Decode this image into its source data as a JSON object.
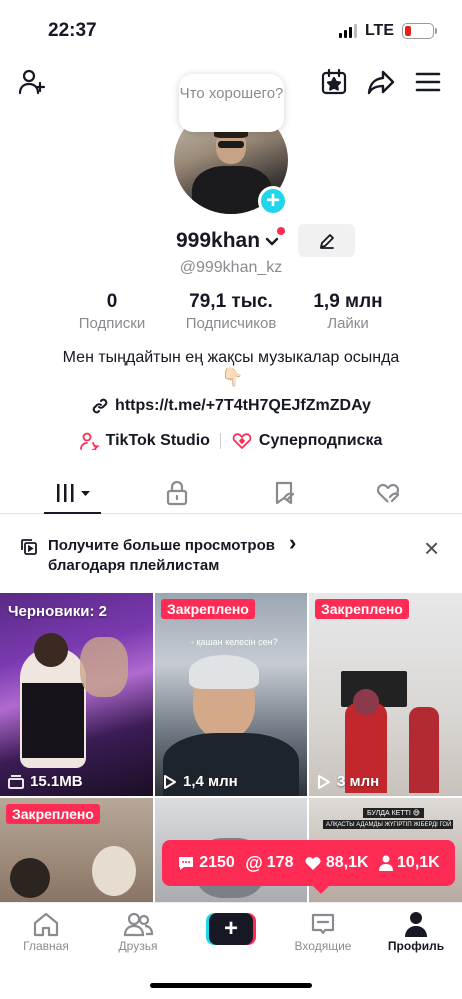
{
  "status_bar": {
    "time": "22:37",
    "network": "LTE"
  },
  "profile": {
    "prompt_bubble": "Что хорошего?",
    "username": "999khan",
    "handle": "@999khan_kz",
    "stats": [
      {
        "value": "0",
        "label": "Подписки"
      },
      {
        "value": "79,1 тыс.",
        "label": "Подписчиков"
      },
      {
        "value": "1,9 млн",
        "label": "Лайки"
      }
    ],
    "bio": "Мен тыңдайтын ең жақсы музыкалар осында",
    "bio_emoji": "👇🏻",
    "link": "https://t.me/+7T4tH7QEJfZmZDAy",
    "tiktok_studio": "TikTok Studio",
    "superfollow": "Суперподписка"
  },
  "banner": {
    "text": "Получите больше просмотров благодаря плейлистам",
    "chevron": "›",
    "close": "×"
  },
  "grid": {
    "drafts_label": "Черновики: 2",
    "drafts_size": "15.1MB",
    "pinned_label": "Закреплено",
    "video2_caption": "- қашан келесін сен?",
    "video2_views": "1,4 млн",
    "video3_views": "3 млн",
    "video6_caption_1": "БУЛДА КЕТТІ 😅",
    "video6_caption_2": "АЛҚАСТЫ АДАМДЫ ЖҮГІРТІП ЖІБЕРДІ ГОЙ 😂😂"
  },
  "stats_popup": {
    "comments": "2150",
    "mentions": "178",
    "likes": "88,1K",
    "followers": "10,1K"
  },
  "nav": {
    "home": "Главная",
    "friends": "Друзья",
    "inbox": "Входящие",
    "profile": "Профиль"
  },
  "colors": {
    "accent": "#fe2c55",
    "cyan": "#20d5ec",
    "text": "#161823",
    "muted": "#8a8b91"
  }
}
